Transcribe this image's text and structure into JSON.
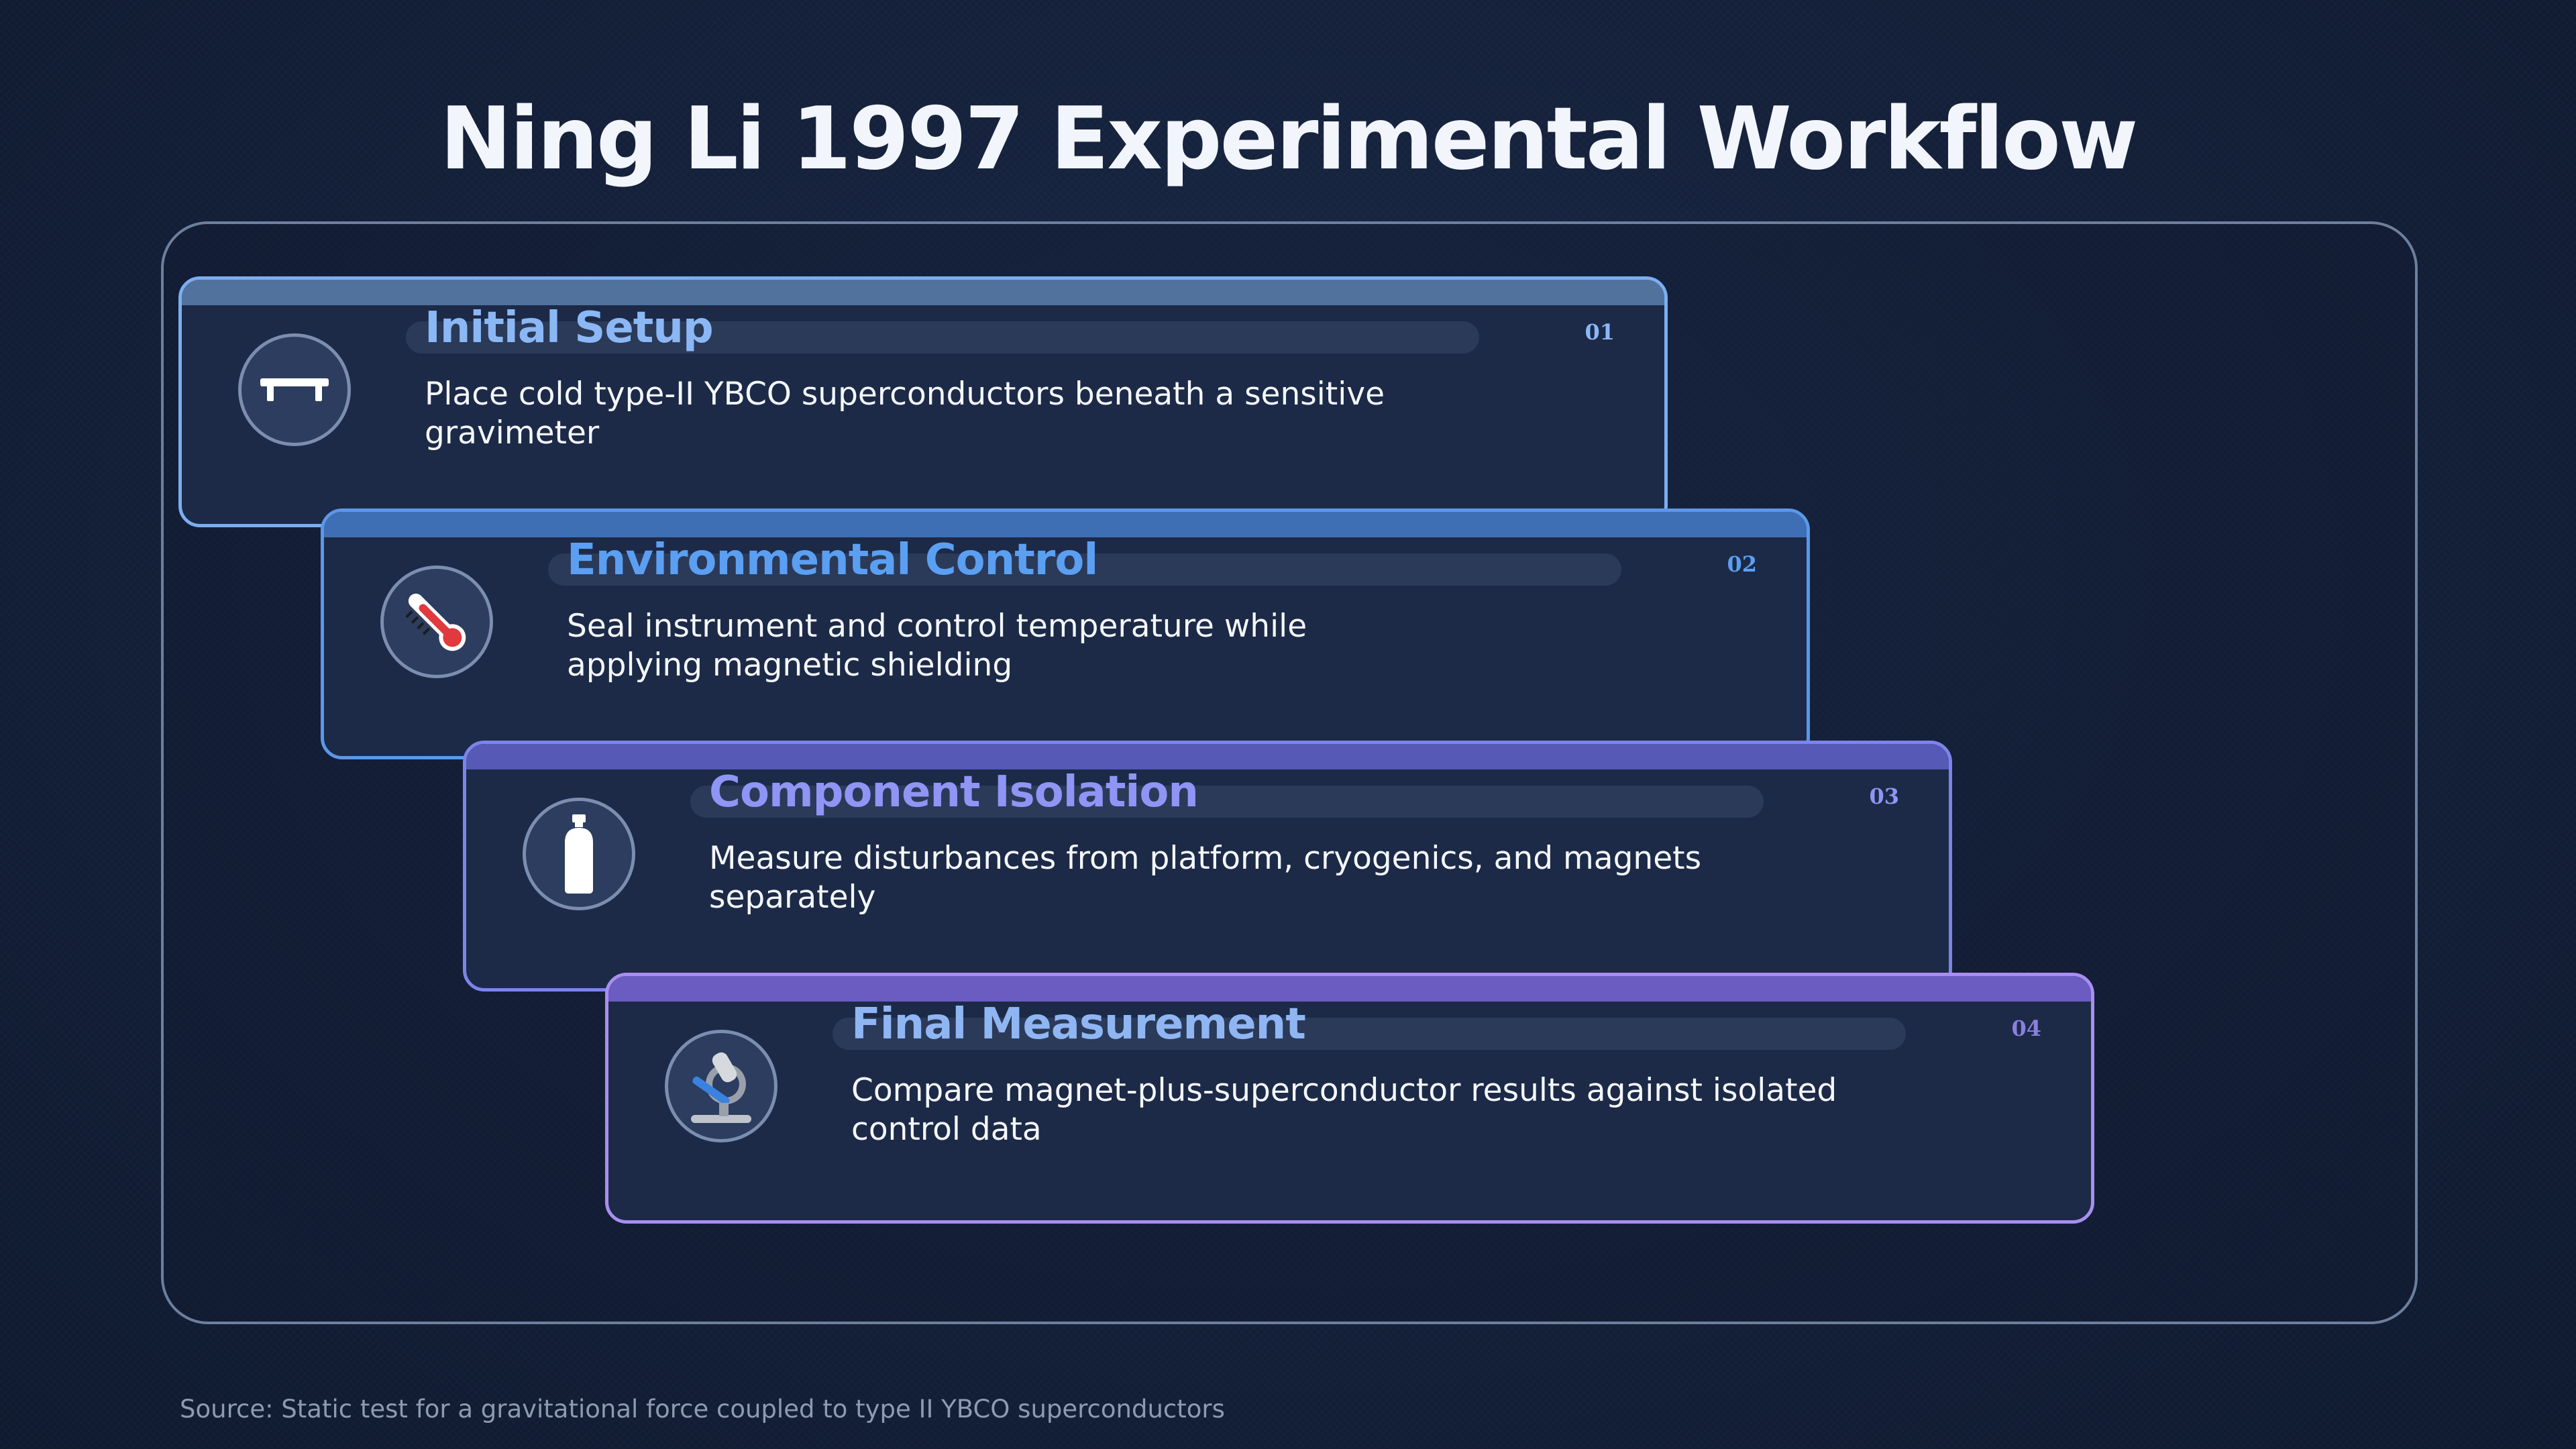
{
  "title": "Ning Li 1997 Experimental Workflow",
  "steps": [
    {
      "number": "01",
      "title": "Initial Setup",
      "description": "Place cold type-II YBCO superconductors beneath a sensitive gravimeter",
      "icon": "platform-icon",
      "accent": "#8bb8f5",
      "border": "#7aaef0"
    },
    {
      "number": "02",
      "title": "Environmental Control",
      "description": "Seal instrument and control temperature while applying magnetic shielding",
      "icon": "thermometer-icon",
      "accent": "#5b9ff2",
      "border": "#5c97e8"
    },
    {
      "number": "03",
      "title": "Component Isolation",
      "description": "Measure disturbances from platform, cryogenics, and magnets separately",
      "icon": "gas-cylinder-icon",
      "accent": "#8f95f5",
      "border": "#7d84e8"
    },
    {
      "number": "04",
      "title": "Final Measurement",
      "description": "Compare magnet-plus-superconductor results against isolated control data",
      "icon": "microscope-icon",
      "accent": "#8fb6f3",
      "border": "#a98ef0"
    }
  ],
  "source": "Source: Static test for a gravitational force coupled to type II YBCO superconductors"
}
